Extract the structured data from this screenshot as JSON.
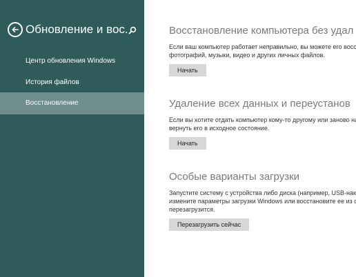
{
  "sidebar": {
    "title": "Обновление и вос...",
    "items": [
      {
        "label": "Центр обновления Windows",
        "selected": false
      },
      {
        "label": "История файлов",
        "selected": false
      },
      {
        "label": "Восстановление",
        "selected": true
      }
    ]
  },
  "sections": [
    {
      "heading": "Восстановление компьютера без удал",
      "desc_lines": [
        "Если ваш компьютер работает неправильно, вы можете его восстан",
        "фотографий, музыки, видео и других личных файлов."
      ],
      "button": "Начать"
    },
    {
      "heading": "Удаление всех данных и переустанов",
      "desc_lines": [
        "Если вы хотите отдать компьютер кому-то другому или заново нача",
        "вернуть его в исходное состояние."
      ],
      "button": "Начать"
    },
    {
      "heading": "Особые варианты загрузки",
      "desc_lines": [
        "Запустите систему с устройства либо диска (например, USB-накопи",
        "измените параметры загрузки Windows или восстановите ее из обр",
        "перезагрузится."
      ],
      "button": "Перезагрузить сейчас"
    }
  ],
  "icons": {
    "back": "back-arrow-icon",
    "search": "search-icon"
  },
  "colors": {
    "sidebar_bg": "#2f5b5a",
    "sidebar_selected": "#6f8d8c",
    "heading": "#7a7a7a",
    "button_bg": "#d7d7d7"
  }
}
